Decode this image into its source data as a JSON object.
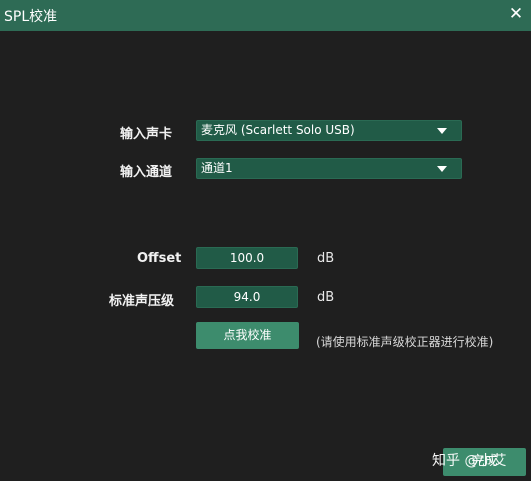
{
  "window": {
    "title": "SPL校准",
    "close_glyph": "✕"
  },
  "form": {
    "input_card_label": "输入声卡",
    "input_card_value": "麦克风 (Scarlett Solo USB)",
    "input_channel_label": "输入通道",
    "input_channel_value": "通道1",
    "offset_label": "Offset",
    "offset_value": "100.0",
    "offset_unit": "dB",
    "spl_label": "标准声压级",
    "spl_value": "94.0",
    "spl_unit": "dB",
    "calibrate_button": "点我校准",
    "calibrate_hint": "(请使用标准声级校正器进行校准)"
  },
  "footer": {
    "finish_button": "完成",
    "watermark": "知乎 @小艾"
  },
  "colors": {
    "titlebar": "#2e6b55",
    "background": "#1f1f1f",
    "field": "#215b47",
    "button": "#3d8c6d"
  }
}
